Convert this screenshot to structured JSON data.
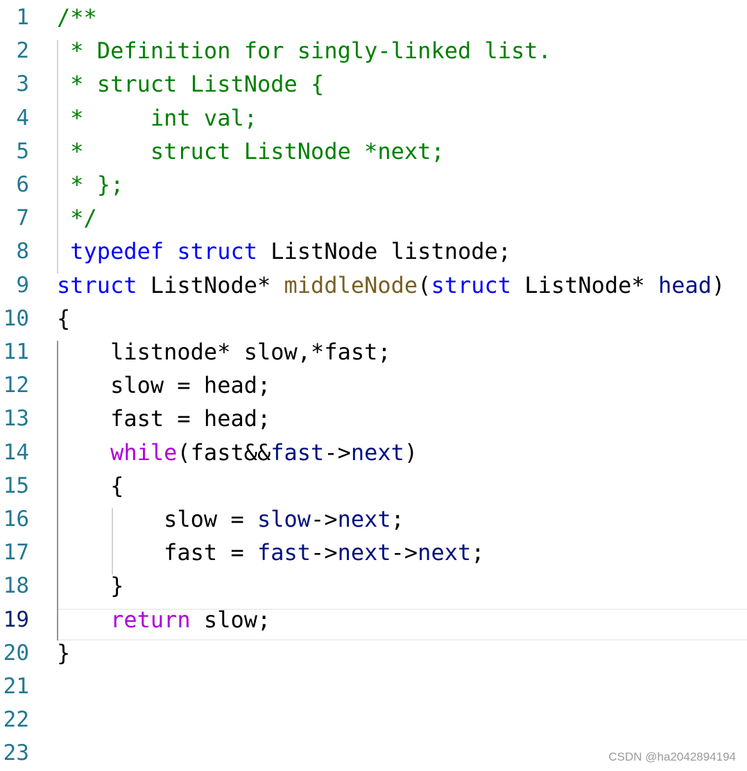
{
  "editor": {
    "line_numbers": [
      "1",
      "2",
      "3",
      "4",
      "5",
      "6",
      "7",
      "8",
      "9",
      "10",
      "11",
      "12",
      "13",
      "14",
      "15",
      "16",
      "17",
      "18",
      "19",
      "20",
      "21",
      "22",
      "23"
    ],
    "active_line": "19",
    "lines": [
      [
        {
          "t": "/**",
          "c": "comment"
        }
      ],
      [
        {
          "t": " * Definition for singly-linked list.",
          "c": "comment"
        }
      ],
      [
        {
          "t": " * struct ListNode {",
          "c": "comment"
        }
      ],
      [
        {
          "t": " *     int val;",
          "c": "comment"
        }
      ],
      [
        {
          "t": " *     struct ListNode *next;",
          "c": "comment"
        }
      ],
      [
        {
          "t": " * };",
          "c": "comment"
        }
      ],
      [
        {
          "t": " */",
          "c": "comment"
        }
      ],
      [
        {
          "t": " typedef",
          "c": "keyword"
        },
        {
          "t": " ",
          "c": "plain"
        },
        {
          "t": "struct",
          "c": "keyword"
        },
        {
          "t": " ListNode listnode;",
          "c": "plain"
        }
      ],
      [
        {
          "t": "struct",
          "c": "keyword"
        },
        {
          "t": " ListNode* ",
          "c": "plain"
        },
        {
          "t": "middleNode",
          "c": "func"
        },
        {
          "t": "(",
          "c": "plain"
        },
        {
          "t": "struct",
          "c": "keyword"
        },
        {
          "t": " ListNode* ",
          "c": "plain"
        },
        {
          "t": "head",
          "c": "var"
        },
        {
          "t": ")",
          "c": "plain"
        }
      ],
      [
        {
          "t": "{",
          "c": "plain"
        }
      ],
      [
        {
          "t": "    listnode* slow,*fast;",
          "c": "plain"
        }
      ],
      [
        {
          "t": "    slow = head;",
          "c": "plain"
        }
      ],
      [
        {
          "t": "    fast = head;",
          "c": "plain"
        }
      ],
      [
        {
          "t": "    ",
          "c": "plain"
        },
        {
          "t": "while",
          "c": "control"
        },
        {
          "t": "(fast&&",
          "c": "plain"
        },
        {
          "t": "fast",
          "c": "var"
        },
        {
          "t": "->",
          "c": "plain"
        },
        {
          "t": "next",
          "c": "var"
        },
        {
          "t": ")",
          "c": "plain"
        }
      ],
      [
        {
          "t": "    {",
          "c": "plain"
        }
      ],
      [
        {
          "t": "        slow = ",
          "c": "plain"
        },
        {
          "t": "slow",
          "c": "var"
        },
        {
          "t": "->",
          "c": "plain"
        },
        {
          "t": "next",
          "c": "var"
        },
        {
          "t": ";",
          "c": "plain"
        }
      ],
      [
        {
          "t": "        fast = ",
          "c": "plain"
        },
        {
          "t": "fast",
          "c": "var"
        },
        {
          "t": "->",
          "c": "plain"
        },
        {
          "t": "next",
          "c": "var"
        },
        {
          "t": "->",
          "c": "plain"
        },
        {
          "t": "next",
          "c": "var"
        },
        {
          "t": ";",
          "c": "plain"
        }
      ],
      [
        {
          "t": "    }",
          "c": "plain"
        }
      ],
      [
        {
          "t": "    ",
          "c": "plain"
        },
        {
          "t": "return",
          "c": "control"
        },
        {
          "t": " slow;",
          "c": "plain"
        }
      ],
      [
        {
          "t": "}",
          "c": "plain"
        }
      ],
      [],
      [],
      []
    ]
  },
  "colors": {
    "comment": "#008000",
    "keyword": "#0000ff",
    "control": "#af00db",
    "function": "#795e26",
    "variable": "#001080",
    "line_number": "#237893"
  },
  "watermark": "CSDN @ha2042894194"
}
